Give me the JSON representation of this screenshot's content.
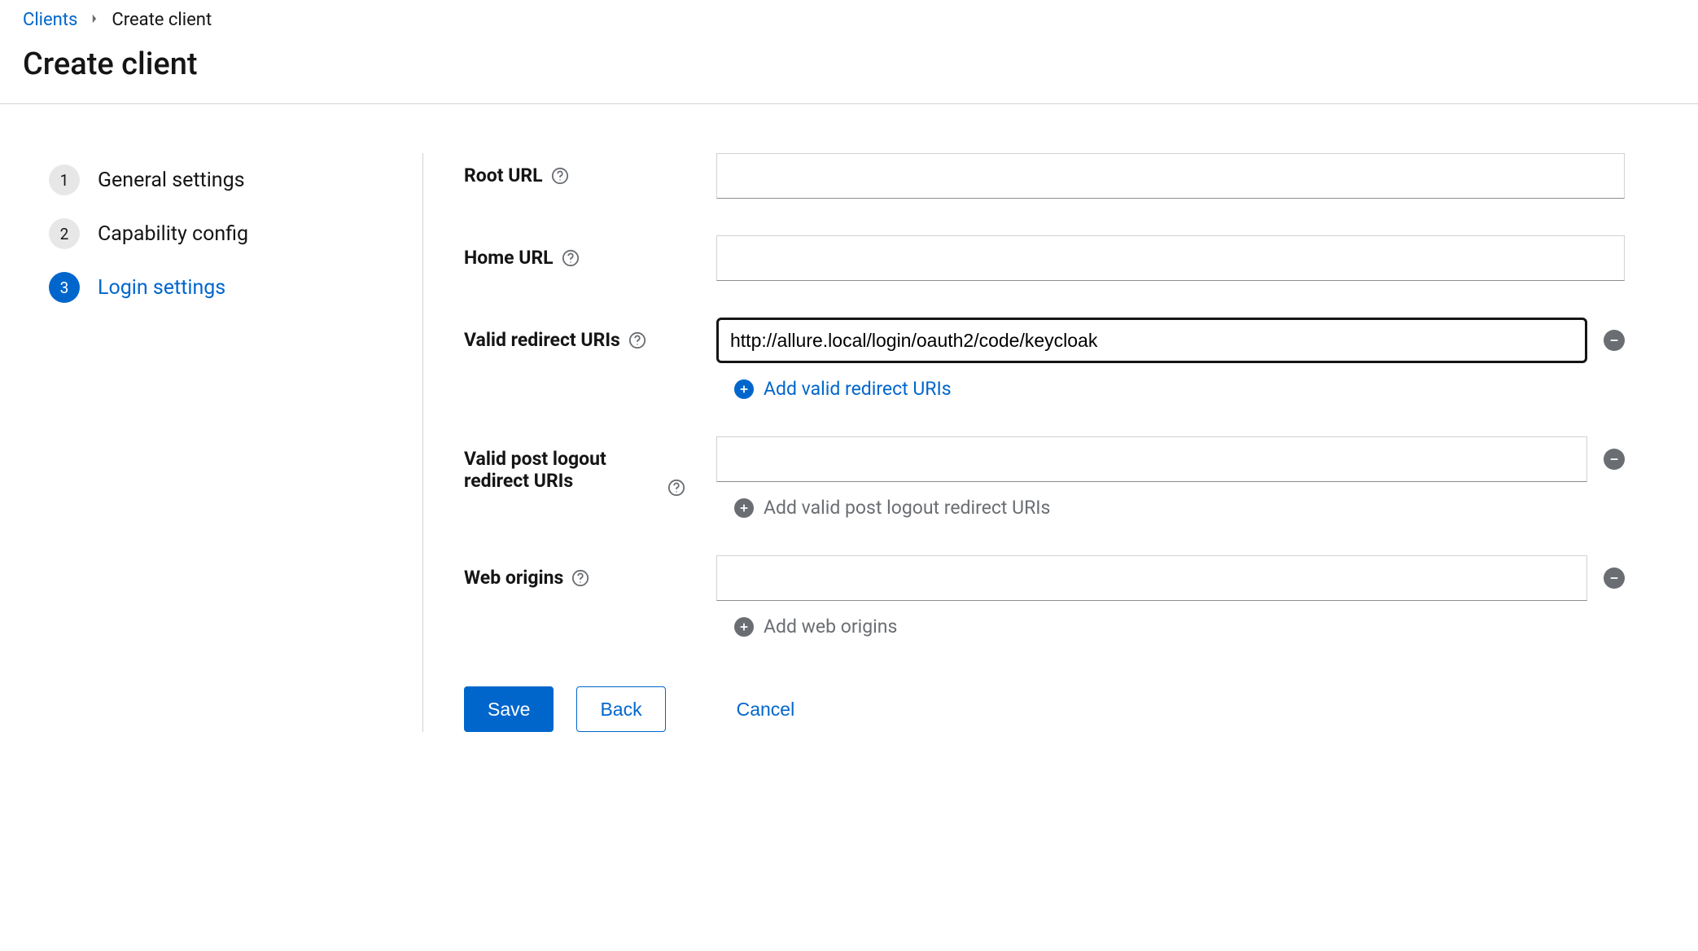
{
  "breadcrumb": {
    "parent_link": "Clients",
    "current": "Create client"
  },
  "page_title": "Create client",
  "steps": [
    {
      "number": "1",
      "label": "General settings",
      "active": false
    },
    {
      "number": "2",
      "label": "Capability config",
      "active": false
    },
    {
      "number": "3",
      "label": "Login settings",
      "active": true
    }
  ],
  "form": {
    "root_url": {
      "label": "Root URL",
      "value": ""
    },
    "home_url": {
      "label": "Home URL",
      "value": ""
    },
    "valid_redirect_uris": {
      "label": "Valid redirect URIs",
      "values": [
        "http://allure.local/login/oauth2/code/keycloak"
      ],
      "add_label": "Add valid redirect URIs"
    },
    "valid_post_logout_redirect_uris": {
      "label": "Valid post logout redirect URIs",
      "values": [
        ""
      ],
      "add_label": "Add valid post logout redirect URIs"
    },
    "web_origins": {
      "label": "Web origins",
      "values": [
        ""
      ],
      "add_label": "Add web origins"
    }
  },
  "actions": {
    "save": "Save",
    "back": "Back",
    "cancel": "Cancel"
  }
}
